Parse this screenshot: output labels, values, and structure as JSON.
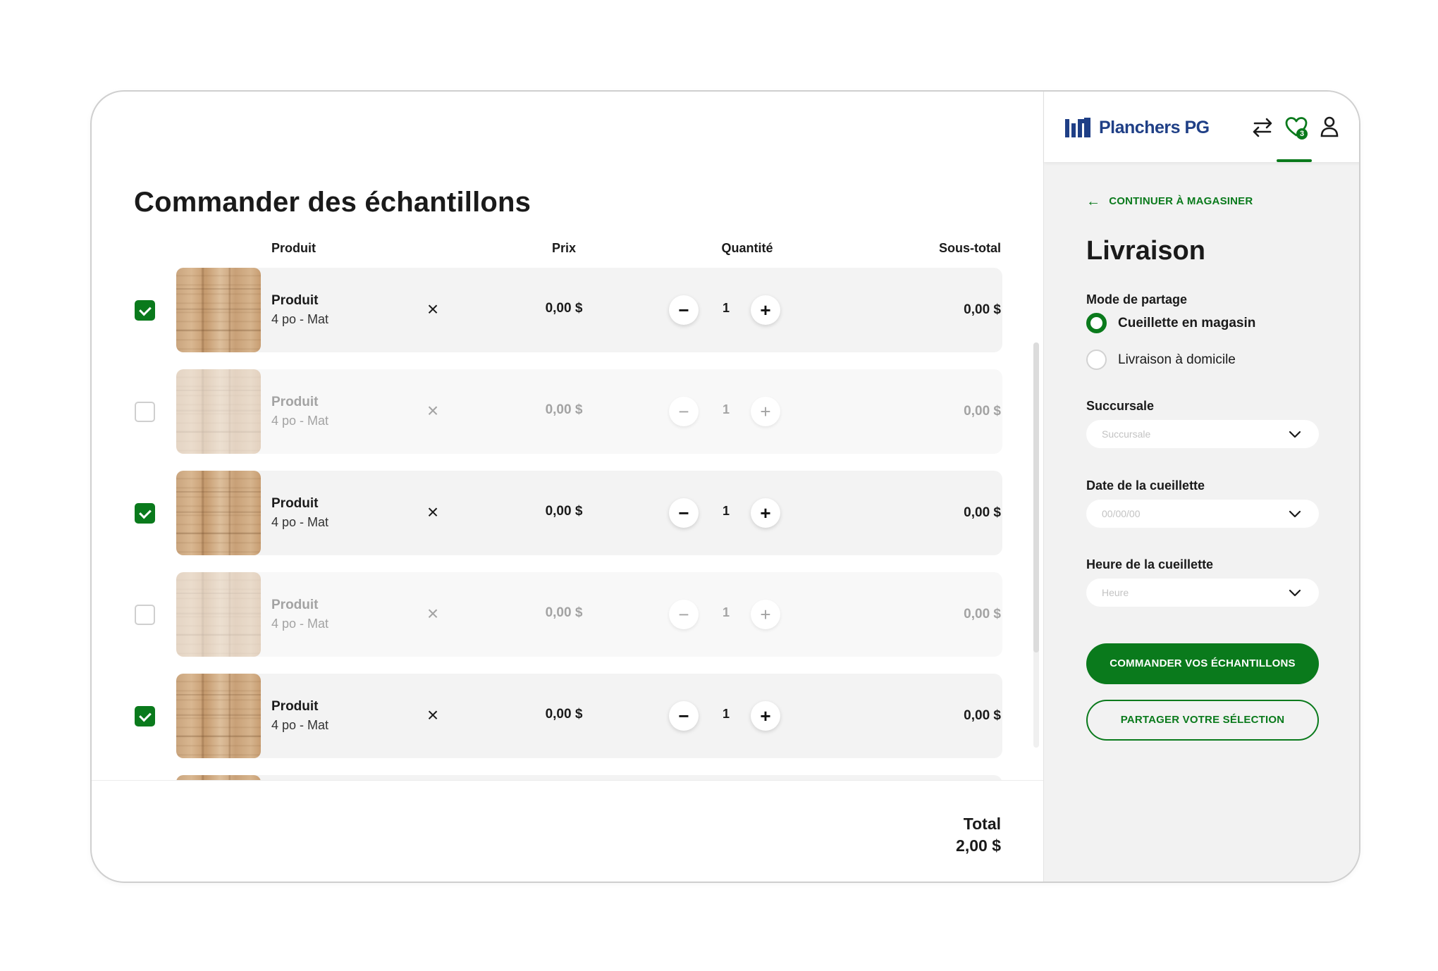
{
  "page": {
    "title": "Commander des échantillons"
  },
  "table": {
    "headers": {
      "product": "Produit",
      "price": "Prix",
      "quantity": "Quantité",
      "subtotal": "Sous-total"
    },
    "remove_symbol": "×",
    "rows": [
      {
        "checked": true,
        "name": "Produit",
        "desc": "4 po - Mat",
        "price": "0,00 $",
        "qty": "1",
        "subtotal": "0,00 $"
      },
      {
        "checked": false,
        "name": "Produit",
        "desc": "4 po - Mat",
        "price": "0,00 $",
        "qty": "1",
        "subtotal": "0,00 $"
      },
      {
        "checked": true,
        "name": "Produit",
        "desc": "4 po - Mat",
        "price": "0,00 $",
        "qty": "1",
        "subtotal": "0,00 $"
      },
      {
        "checked": false,
        "name": "Produit",
        "desc": "4 po - Mat",
        "price": "0,00 $",
        "qty": "1",
        "subtotal": "0,00 $"
      },
      {
        "checked": true,
        "name": "Produit",
        "desc": "4 po - Mat",
        "price": "0,00 $",
        "qty": "1",
        "subtotal": "0,00 $"
      },
      {
        "checked": true,
        "name": "",
        "desc": "",
        "price": "",
        "qty": "",
        "subtotal": ""
      }
    ]
  },
  "footer": {
    "total_label": "Total",
    "total_value": "2,00 $"
  },
  "header": {
    "brand": "Planchers PG",
    "favorites_count": "3",
    "icons": [
      "compare-arrows-icon",
      "heart-icon",
      "user-icon"
    ]
  },
  "sidebar": {
    "continue_label": "CONTINUER À MAGASINER",
    "title": "Livraison",
    "mode_label": "Mode de partage",
    "options": [
      {
        "label": "Cueillette en magasin",
        "selected": true
      },
      {
        "label": "Livraison à domicile",
        "selected": false
      }
    ],
    "branch_label": "Succursale",
    "branch_placeholder": "Succursale",
    "date_label": "Date de la cueillette",
    "date_placeholder": "00/00/00",
    "time_label": "Heure de la cueillette",
    "time_placeholder": "Heure",
    "order_button": "COMMANDER VOS ÉCHANTILLONS",
    "share_button": "PARTAGER VOTRE SÉLECTION"
  },
  "colors": {
    "accent": "#0a7a1c",
    "brand": "#1f3f86"
  }
}
